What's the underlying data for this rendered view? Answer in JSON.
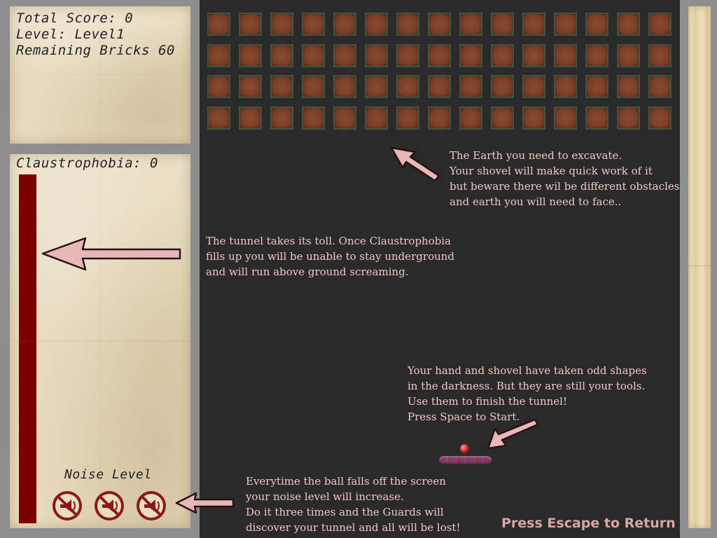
{
  "hud": {
    "total_score": "Total Score: 0",
    "level": "Level: Level1",
    "remaining_bricks": "Remaining Bricks 60",
    "claustrophobia": "Claustrophobia: 0",
    "noise_level_label": "Noise Level"
  },
  "claustrophobia_fill": 0,
  "noise_icons": [
    "muted-horn-icon",
    "muted-horn-icon",
    "muted-horn-icon"
  ],
  "bricks": {
    "rows": 4,
    "cols": 15,
    "total": 60
  },
  "hints": {
    "earth": [
      "The Earth you need to excavate.",
      "Your shovel will make quick work of  it",
      "but beware  there wil be different obstacles",
      "and earth you will need to face.."
    ],
    "tunnel": [
      "The tunnel takes its toll. Once Claustrophobia",
      "fills up you will be unable to stay underground",
      "and will run above ground screaming."
    ],
    "hand": [
      "Your hand and shovel have taken odd shapes",
      "in the darkness. But they are still your tools.",
      "Use them to finish the tunnel!",
      "Press Space to Start."
    ],
    "ball": [
      "Everytime the ball falls off  the screen",
      "your noise level will increase.",
      "Do it three times and the Guards will",
      "discover your tunnel and all will be lost!"
    ]
  },
  "escape_text": "Press Escape to Return",
  "colors": {
    "background": "#2a2a2a",
    "hint_text": "#f0c7c4",
    "bar": "#7a0000",
    "escape": "#d8a6a3",
    "arrow_fill": "#e8b8b8"
  }
}
